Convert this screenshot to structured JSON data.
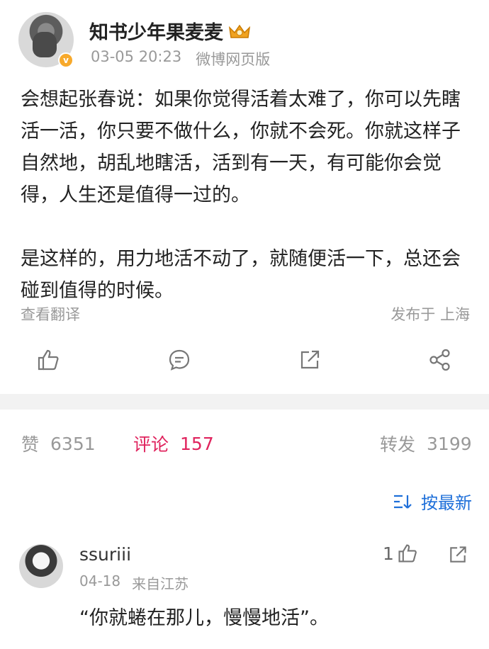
{
  "post": {
    "author": "知书少年果麦麦",
    "timestamp": "03-05 20:23",
    "source": "微博网页版",
    "paragraph_1": "会想起张春说：如果你觉得活着太难了，你可以先瞎活一活，你只要不做什么，你就不会死。你就这样子自然地，胡乱地瞎活，活到有一天，有可能你会觉得，人生还是值得一过的。",
    "paragraph_2": "是这样的，用力地活不动了，就随便活一下，总还会碰到值得的时候。",
    "translate_label": "查看翻译",
    "location": "发布于 上海"
  },
  "actions": [
    "like-icon",
    "comment-icon",
    "repost-icon",
    "share-icon"
  ],
  "stats": {
    "likes_label": "赞",
    "likes_count": "6351",
    "comments_label": "评论",
    "comments_count": "157",
    "reposts_label": "转发",
    "reposts_count": "3199"
  },
  "sort": {
    "icon": "sort-icon",
    "label": "按最新"
  },
  "comment": {
    "username": "ssuriii",
    "date": "04-18",
    "origin": "来自江苏",
    "like_count": "1",
    "text": "“你就蜷在那儿，慢慢地活”。"
  },
  "colors": {
    "accent": "#e0245e",
    "link": "#1e6fd9",
    "muted": "#999999"
  }
}
